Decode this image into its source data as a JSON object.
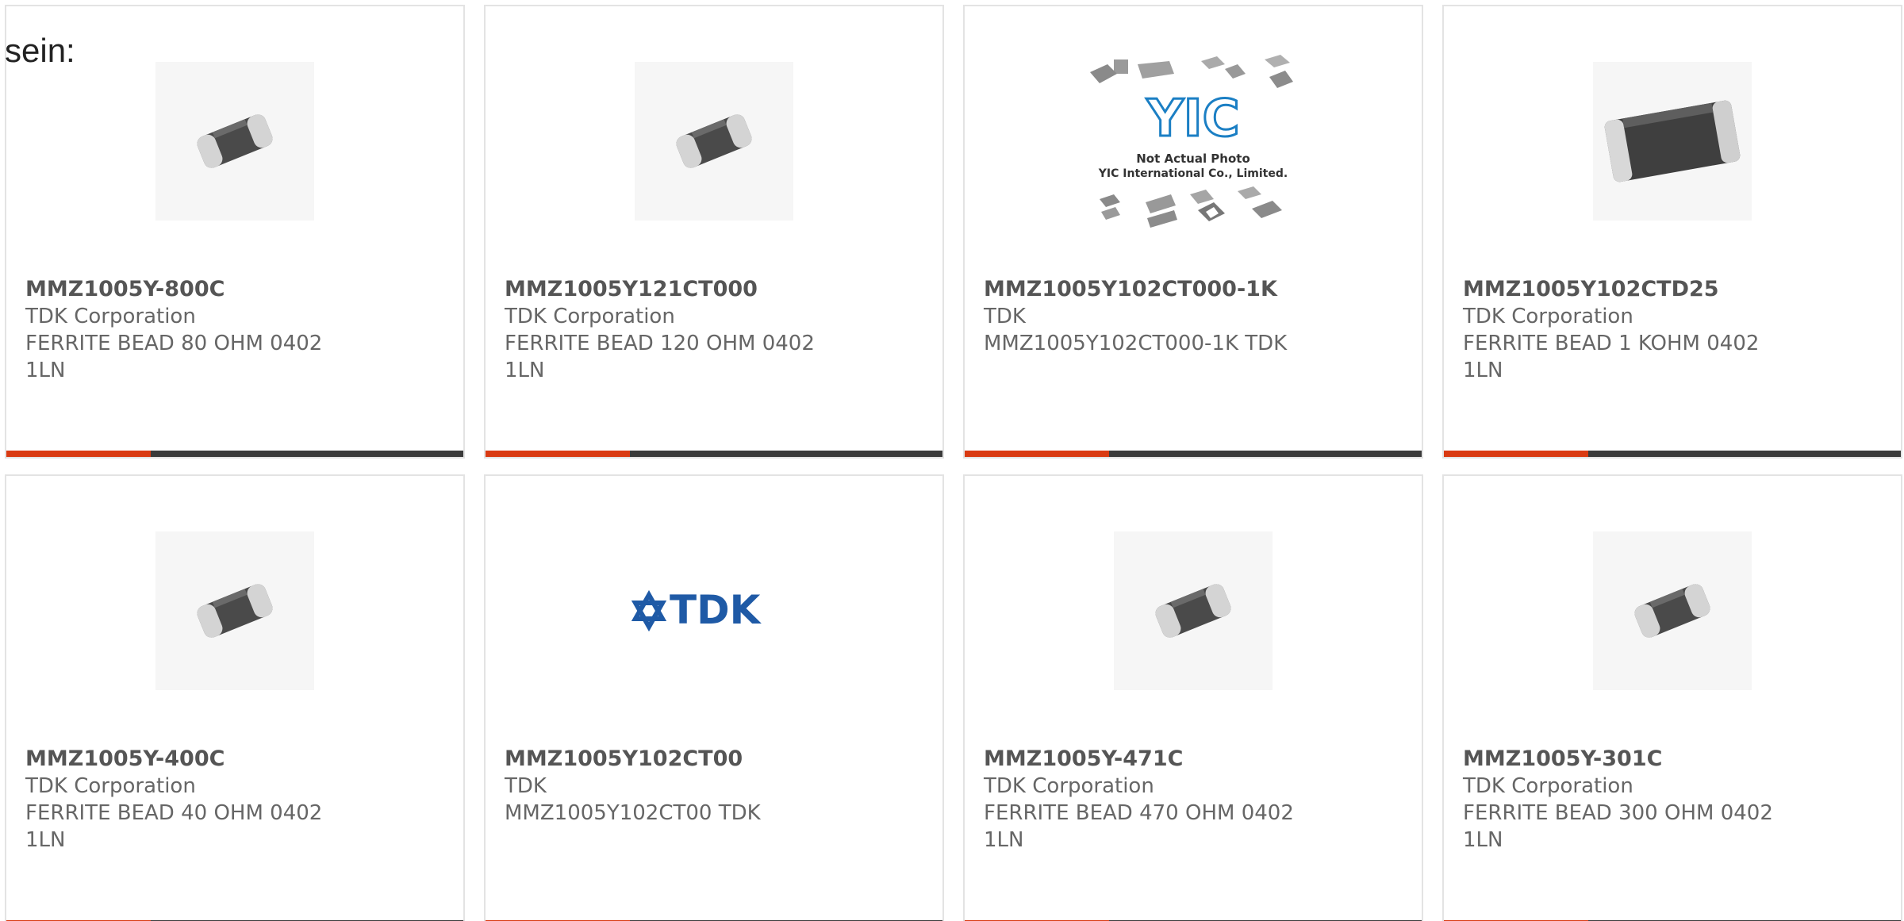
{
  "intro_text": "sein:",
  "colors": {
    "accent": "#d93a12",
    "bar": "#3a3a3a",
    "border": "#e3e3e3",
    "text": "#666666",
    "tdk_blue": "#1f5aa6",
    "yic_blue": "#1b7fc4"
  },
  "products": [
    {
      "title": "MMZ1005Y-800C",
      "maker": "TDK Corporation",
      "description": "FERRITE BEAD 80 OHM 0402 1LN",
      "image": "ferrite-bead-chip-small"
    },
    {
      "title": "MMZ1005Y121CT000",
      "maker": "TDK Corporation",
      "description": "FERRITE BEAD 120 OHM 0402 1LN",
      "image": "ferrite-bead-chip-small"
    },
    {
      "title": "MMZ1005Y102CT000-1K",
      "maker": "TDK",
      "description": "MMZ1005Y102CT000-1K TDK",
      "image": "yic-placeholder",
      "image_text": {
        "logo": "YIC",
        "line1": "Not Actual Photo",
        "line2": "YIC International Co., Limited."
      }
    },
    {
      "title": "MMZ1005Y102CTD25",
      "maker": "TDK Corporation",
      "description": "FERRITE BEAD 1 KOHM 0402 1LN",
      "image": "ferrite-bead-chip-large"
    },
    {
      "title": "MMZ1005Y-400C",
      "maker": "TDK Corporation",
      "description": "FERRITE BEAD 40 OHM 0402 1LN",
      "image": "ferrite-bead-chip-small"
    },
    {
      "title": "MMZ1005Y102CT00",
      "maker": "TDK",
      "description": "MMZ1005Y102CT00 TDK",
      "image": "tdk-logo",
      "image_text": {
        "logo": "TDK"
      }
    },
    {
      "title": "MMZ1005Y-471C",
      "maker": "TDK Corporation",
      "description": "FERRITE BEAD 470 OHM 0402 1LN",
      "image": "ferrite-bead-chip-small"
    },
    {
      "title": "MMZ1005Y-301C",
      "maker": "TDK Corporation",
      "description": "FERRITE BEAD 300 OHM 0402 1LN",
      "image": "ferrite-bead-chip-small"
    }
  ]
}
